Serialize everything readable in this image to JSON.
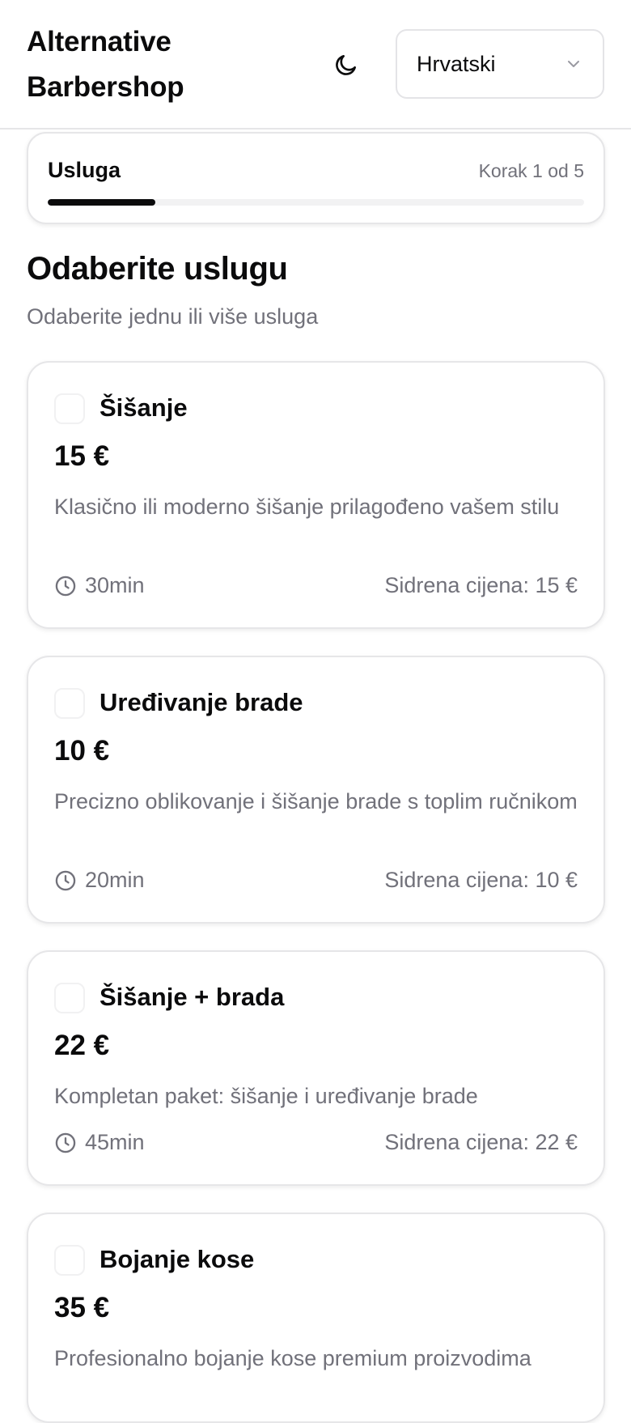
{
  "header": {
    "brand": "Alternative Barbershop",
    "theme_icon": "moon-icon",
    "language": {
      "selected": "Hrvatski",
      "icon": "chevron-down-icon"
    }
  },
  "progress": {
    "step_name": "Usluga",
    "step_count": "Korak 1 od 5",
    "fraction": 0.2
  },
  "section": {
    "title": "Odaberite uslugu",
    "subtitle": "Odaberite jednu ili više usluga"
  },
  "services": [
    {
      "name": "Šišanje",
      "price": "15 €",
      "description": "Klasično ili moderno šišanje prilagođeno vašem stilu",
      "duration": "30min",
      "anchor_price": "Sidrena cijena: 15 €"
    },
    {
      "name": "Uređivanje brade",
      "price": "10 €",
      "description": "Precizno oblikovanje i šišanje brade s toplim ručnikom",
      "duration": "20min",
      "anchor_price": "Sidrena cijena: 10 €"
    },
    {
      "name": "Šišanje + brada",
      "price": "22 €",
      "description": "Kompletan paket: šišanje i uređivanje brade",
      "duration": "45min",
      "anchor_price": "Sidrena cijena: 22 €"
    },
    {
      "name": "Bojanje kose",
      "price": "35 €",
      "description": "Profesionalno bojanje kose premium proizvodima",
      "duration": "",
      "anchor_price": ""
    }
  ],
  "colors": {
    "text": "#0b0b0c",
    "muted": "#71717a",
    "border": "#e6e6e8",
    "progress_fill": "#0b0b0c",
    "progress_track": "#f2f2f3"
  }
}
